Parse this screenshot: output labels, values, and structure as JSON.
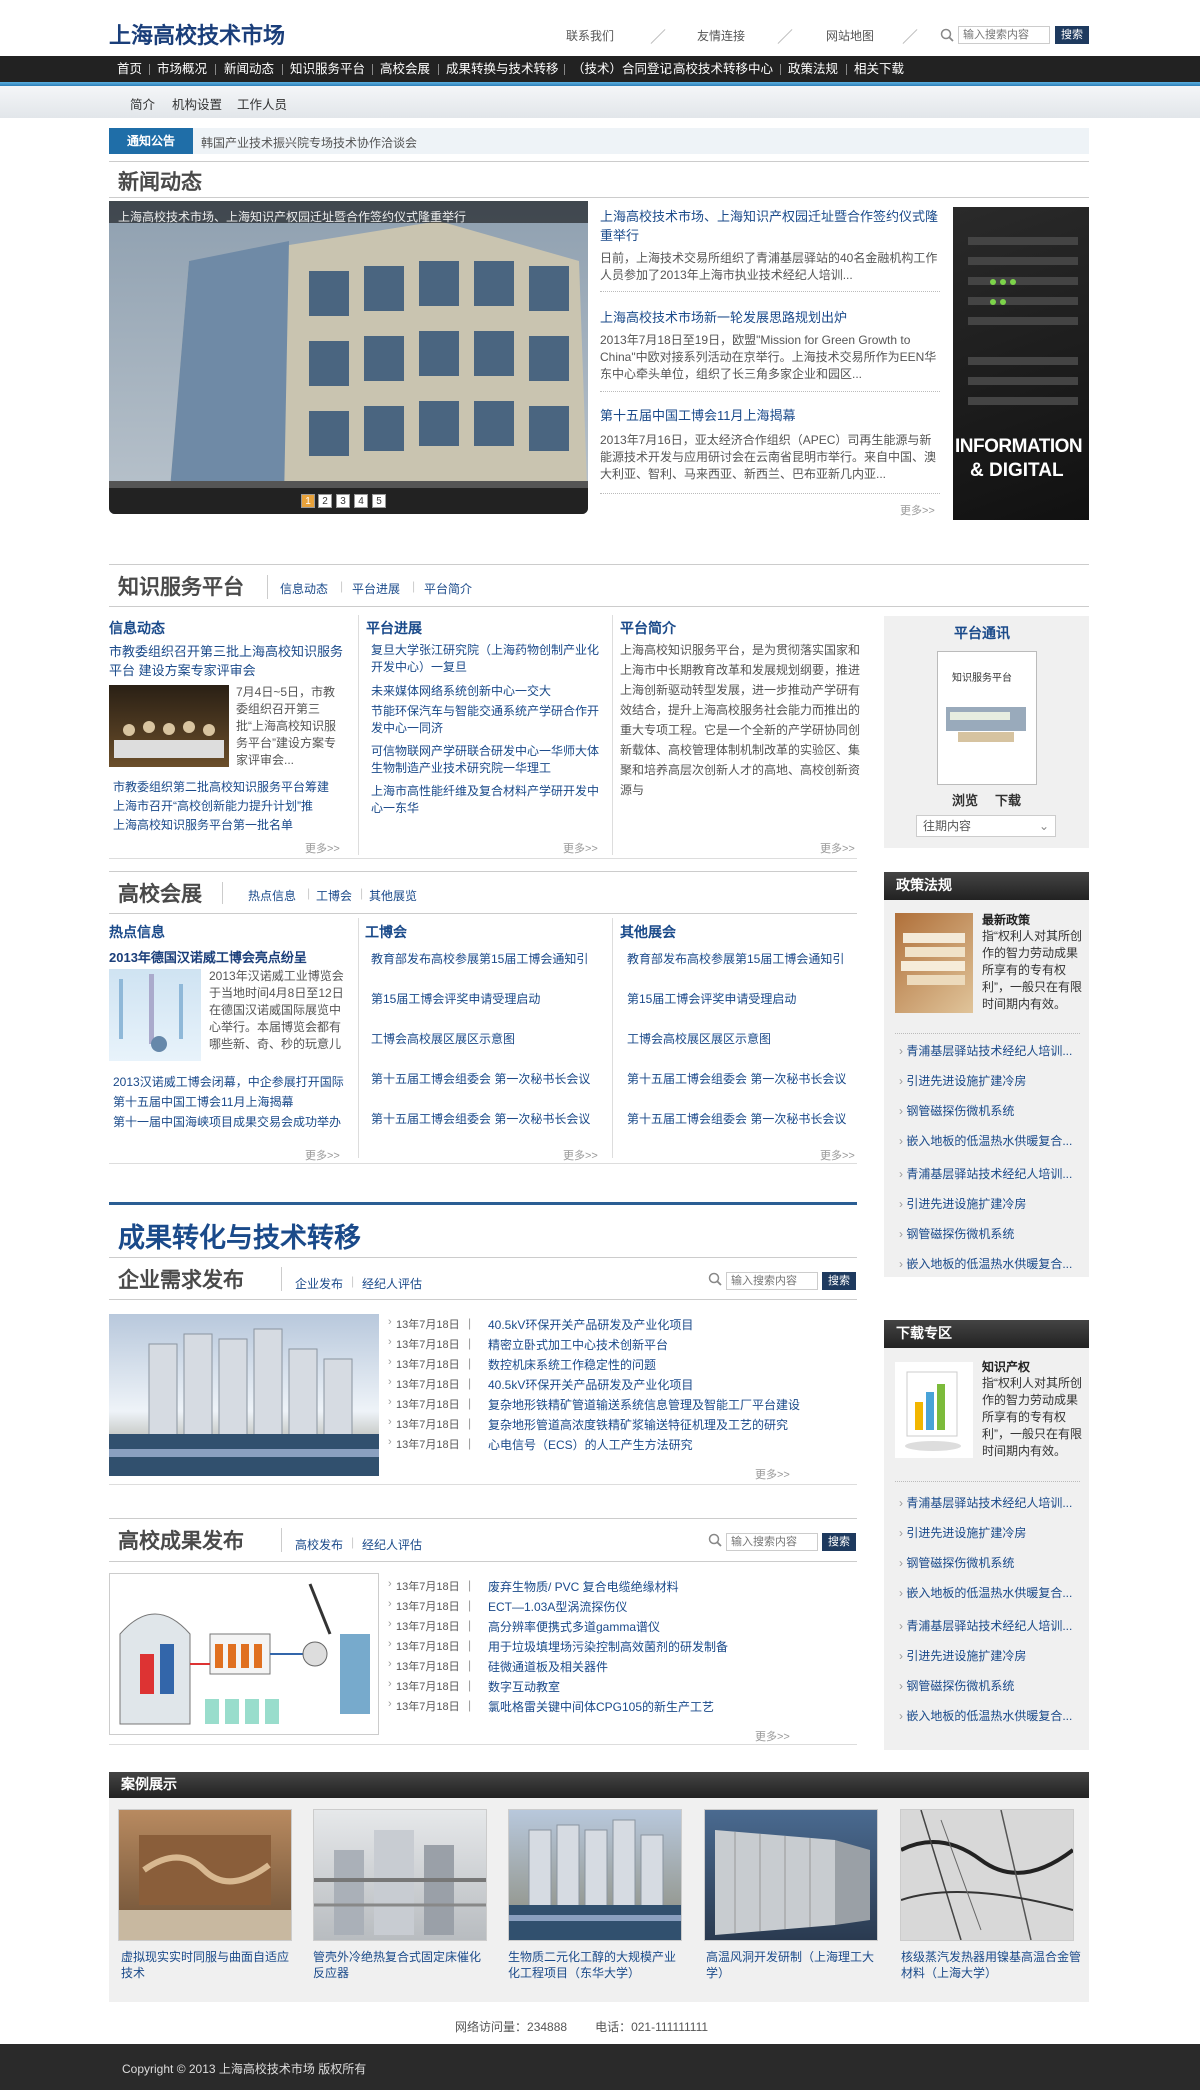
{
  "site": {
    "logo": "上海高校技术市场",
    "top_links": [
      "联系我们",
      "友情连接",
      "网站地图"
    ],
    "search_placeholder": "输入搜索内容",
    "search_btn": "搜索"
  },
  "nav": [
    "首页",
    "市场概况",
    "新闻动态",
    "知识服务平台",
    "高校会展",
    "成果转换与技术转移",
    "（技术）合同登记",
    "高校技术转移中心",
    "政策法规",
    "相关下载"
  ],
  "subnav": [
    "简介",
    "机构设置",
    "工作人员"
  ],
  "notice": {
    "tag": "通知公告",
    "text": "韩国产业技术振兴院专场技术协作洽谈会"
  },
  "news": {
    "title": "新闻动态",
    "slide_caption": "上海高校技术市场、上海知识产权园迁址暨合作签约仪式隆重举行",
    "slide_nums": [
      "1",
      "2",
      "3",
      "4",
      "5"
    ],
    "items": [
      {
        "title": "上海高校技术市场、上海知识产权园迁址暨合作签约仪式隆重举行",
        "body": "日前，上海技术交易所组织了青浦基层驿站的40名金融机构工作人员参加了2013年上海市执业技术经纪人培训..."
      },
      {
        "title": "上海高校技术市场新一轮发展思路规划出炉",
        "body": "2013年7月18日至19日，欧盟\"Mission for Green Growth to China\"中欧对接系列活动在京举行。上海技术交易所作为EEN华东中心牵头单位，组织了长三角多家企业和园区..."
      },
      {
        "title": "第十五届中国工博会11月上海揭幕",
        "body": "2013年7月16日，亚太经济合作组织（APEC）司再生能源与新能源技术开发与应用研讨会在云南省昆明市举行。来自中国、澳大利亚、智利、马来西亚、新西兰、巴布亚新几内亚..."
      }
    ],
    "more": "更多>>",
    "side_img_text": [
      "INFORMATION",
      "& DIGITAL"
    ]
  },
  "knowledge": {
    "title": "知识服务平台",
    "tabs": [
      "信息动态",
      "平台进展",
      "平台简介"
    ],
    "col1": {
      "head": "信息动态",
      "headline": "市教委组织召开第三批上海高校知识服务平台 建设方案专家评审会",
      "desc": "7月4日~5日，市教委组织召开第三批“上海高校知识服务平台”建设方案专家评审会...",
      "links": [
        "市教委组织第二批高校知识服务平台筹建",
        "上海市召开“高校创新能力提升计划”推",
        "上海高校知识服务平台第一批名单"
      ]
    },
    "col2": {
      "head": "平台进展",
      "links": [
        "复旦大学张江研究院（上海药物创制产业化开发中心）一复旦",
        "未来媒体网络系统创新中心一交大",
        "节能环保汽车与智能交通系统产学研合作开发中心一同济",
        "可信物联网产学研联合研发中心一华师大体生物制造产业技术研究院一华理工",
        "上海市高性能纤维及复合材料产学研开发中心一东华"
      ]
    },
    "col3": {
      "head": "平台简介",
      "body": "上海高校知识服务平台，是为贯彻落实国家和上海市中长期教育改革和发展规划纲要，推进上海创新驱动转型发展，进一步推动产学研有效结合，提升上海高校服务社会能力而推出的重大专项工程。它是一个全新的产学研协同创新载体、高校管理体制机制改革的实验区、集聚和培养高层次创新人才的高地、高校创新资源与"
    },
    "more": "更多>>"
  },
  "platform_news": {
    "title": "平台通讯",
    "book_title": "知识服务平台",
    "actions": [
      "浏览",
      "下载"
    ],
    "select": "往期内容"
  },
  "expo": {
    "title": "高校会展",
    "tabs": [
      "热点信息",
      "工博会",
      "其他展览"
    ],
    "col1": {
      "head": "热点信息",
      "headline": "2013年德国汉诺威工博会亮点纷呈",
      "desc": "2013年汉诺威工业博览会于当地时间4月8日至12日在德国汉诺威国际展览中心举行。本届博览会都有哪些新、奇、秒的玩意儿",
      "links": [
        "2013汉诺威工博会闭幕，中企参展打开国际",
        "第十五届中国工博会11月上海揭幕",
        "第十一届中国海峡项目成果交易会成功举办"
      ]
    },
    "col2": {
      "head": "工博会",
      "links": [
        "教育部发布高校参展第15届工博会通知引",
        "第15届工博会评奖申请受理启动",
        "工博会高校展区展区示意图",
        "第十五届工博会组委会 第一次秘书长会议",
        "第十五届工博会组委会 第一次秘书长会议"
      ]
    },
    "col3": {
      "head": "其他展会",
      "links": [
        "教育部发布高校参展第15届工博会通知引",
        "第15届工博会评奖申请受理启动",
        "工博会高校展区展区示意图",
        "第十五届工博会组委会 第一次秘书长会议",
        "第十五届工博会组委会 第一次秘书长会议"
      ]
    },
    "more": "更多>>"
  },
  "policy": {
    "title": "政策法规",
    "feature_title": "最新政策",
    "feature_text": "指“权利人对其所创作的智力劳动成果所享有的专有权利”，一般只在有限时间期内有效。",
    "links": [
      "青浦基层驿站技术经纪人培训...",
      "引进先进设施扩建冷房",
      "钢管磁探伤微机系统",
      "嵌入地板的低温热水供暖复合...",
      "青浦基层驿站技术经纪人培训...",
      "引进先进设施扩建冷房",
      "钢管磁探伤微机系统",
      "嵌入地板的低温热水供暖复合..."
    ]
  },
  "transfer": {
    "title": "成果转化与技术转移"
  },
  "enterprise": {
    "title": "企业需求发布",
    "tabs": [
      "企业发布",
      "经纪人评估"
    ],
    "search_placeholder": "输入搜索内容",
    "search_btn": "搜索",
    "items": [
      {
        "date": "13年7月18日",
        "title": "40.5kV环保开关产品研发及产业化项目"
      },
      {
        "date": "13年7月18日",
        "title": "精密立卧式加工中心技术创新平台"
      },
      {
        "date": "13年7月18日",
        "title": "数控机床系统工作稳定性的问题"
      },
      {
        "date": "13年7月18日",
        "title": "40.5kV环保开关产品研发及产业化项目"
      },
      {
        "date": "13年7月18日",
        "title": "复杂地形铁精矿管道输送系统信息管理及智能工厂平台建设"
      },
      {
        "date": "13年7月18日",
        "title": "复杂地形管道高浓度铁精矿浆输送特征机理及工艺的研究"
      },
      {
        "date": "13年7月18日",
        "title": "心电信号（ECS）的人工产生方法研究"
      }
    ],
    "more": "更多>>"
  },
  "download": {
    "title": "下载专区",
    "feature_title": "知识产权",
    "feature_text": "指“权利人对其所创作的智力劳动成果所享有的专有权利”，一般只在有限时间期内有效。",
    "links": [
      "青浦基层驿站技术经纪人培训...",
      "引进先进设施扩建冷房",
      "钢管磁探伤微机系统",
      "嵌入地板的低温热水供暖复合...",
      "青浦基层驿站技术经纪人培训...",
      "引进先进设施扩建冷房",
      "钢管磁探伤微机系统",
      "嵌入地板的低温热水供暖复合..."
    ]
  },
  "college": {
    "title": "高校成果发布",
    "tabs": [
      "高校发布",
      "经纪人评估"
    ],
    "search_placeholder": "输入搜索内容",
    "search_btn": "搜索",
    "items": [
      {
        "date": "13年7月18日",
        "title": "废弃生物质/ PVC 复合电缆绝缘材料"
      },
      {
        "date": "13年7月18日",
        "title": "ECT—1.03A型涡流探伤仪"
      },
      {
        "date": "13年7月18日",
        "title": "高分辨率便携式多道gamma谱仪"
      },
      {
        "date": "13年7月18日",
        "title": "用于垃圾填埋场污染控制高效菌剂的研发制备"
      },
      {
        "date": "13年7月18日",
        "title": "硅微通道板及相关器件"
      },
      {
        "date": "13年7月18日",
        "title": "数字互动教室"
      },
      {
        "date": "13年7月18日",
        "title": "氯吡格雷关键中间体CPG105的新生产工艺"
      }
    ],
    "more": "更多>>"
  },
  "cases": {
    "title": "案例展示",
    "items": [
      "虚拟现实实时同服与曲面自适应技术",
      "管壳外冷绝热复合式固定床催化反应器",
      "生物质二元化工醇的大规模产业化工程项目（东华大学）",
      "高温风洞开发研制（上海理工大学）",
      "核级蒸汽发热器用镍基高温合金管材料（上海大学）"
    ]
  },
  "stats": {
    "visits_label": "网络访问量：",
    "visits": "234888",
    "phone_label": "电话：",
    "phone": "021-111111111"
  },
  "footer": {
    "copyright": "Copyright © 2013 上海高校技术市场  版权所有"
  }
}
